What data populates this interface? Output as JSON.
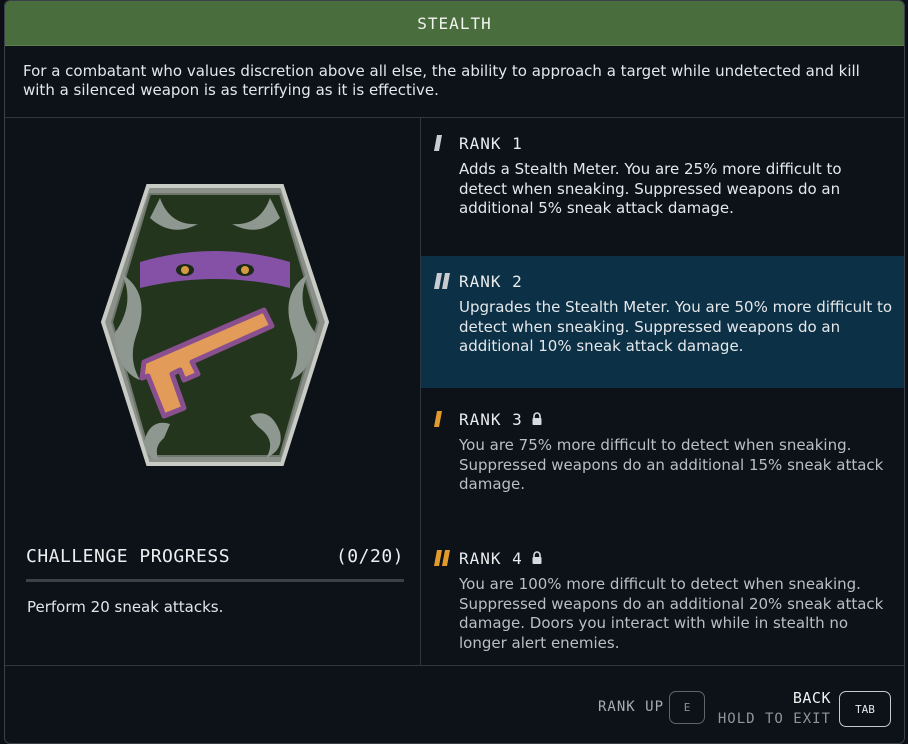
{
  "title": "STEALTH",
  "description": "For a combatant who values discretion above all else, the ability to approach a target while undetected and kill with a silenced weapon is as terrifying as it is effective.",
  "challenge": {
    "heading": "CHALLENGE PROGRESS",
    "progress": "(0/20)",
    "task": "Perform 20 sneak attacks."
  },
  "ranks": [
    {
      "label": "RANK 1",
      "text": "Adds a Stealth Meter. You are 25% more difficult to detect when sneaking. Suppressed weapons do an additional 5% sneak attack damage.",
      "locked": false,
      "active": false
    },
    {
      "label": "RANK 2",
      "text": "Upgrades the Stealth Meter. You are 50% more difficult to detect when sneaking. Suppressed weapons do an additional 10% sneak attack damage.",
      "locked": false,
      "active": true
    },
    {
      "label": "RANK 3",
      "text": "You are 75% more difficult to detect when sneaking. Suppressed weapons do an additional 15% sneak attack damage.",
      "locked": true,
      "active": false
    },
    {
      "label": "RANK 4",
      "text": "You are 100% more difficult to detect when sneaking. Suppressed weapons do an additional 20% sneak attack damage. Doors you interact with while in stealth no longer alert enemies.",
      "locked": true,
      "active": false
    }
  ],
  "footer": {
    "rank_up": "RANK UP",
    "rank_up_key": "E",
    "back": "BACK",
    "hold_to_exit": "HOLD TO EXIT",
    "back_key": "TAB"
  },
  "colors": {
    "title_bar": "#4a6d3e",
    "active_rank_bg": "#0c3045",
    "unlocked_mark": "#c9ccd0",
    "locked_mark": "#e39a2c"
  },
  "icons": {
    "badge": "stealth-badge-icon",
    "lock": "lock-icon"
  }
}
